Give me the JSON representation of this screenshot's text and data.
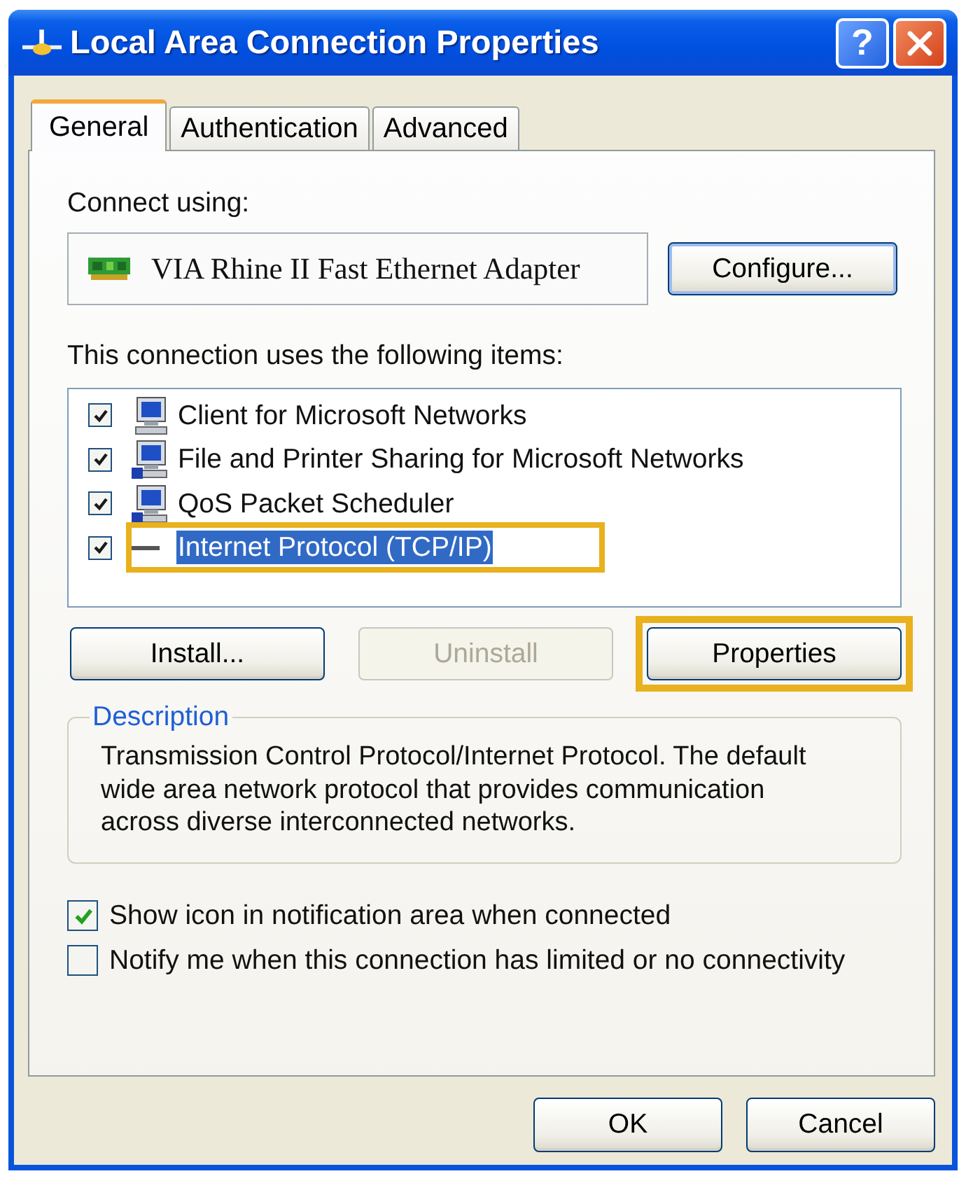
{
  "window": {
    "title": "Local Area Connection Properties",
    "help_button": "?"
  },
  "tabs": [
    {
      "label": "General",
      "selected": true
    },
    {
      "label": "Authentication",
      "selected": false
    },
    {
      "label": "Advanced",
      "selected": false
    }
  ],
  "connect_using": {
    "label": "Connect using:",
    "adapter": "VIA Rhine II Fast Ethernet Adapter",
    "button": "Configure..."
  },
  "components": {
    "label": "This connection uses the following items:",
    "items": [
      {
        "name": "Client for Microsoft Networks",
        "kind": "client",
        "checked": true,
        "selected": false,
        "highlighted": false
      },
      {
        "name": "File and Printer Sharing for Microsoft Networks",
        "kind": "service",
        "checked": true,
        "selected": false,
        "highlighted": false
      },
      {
        "name": "QoS Packet Scheduler",
        "kind": "service",
        "checked": true,
        "selected": false,
        "highlighted": false
      },
      {
        "name": "Internet Protocol (TCP/IP)",
        "kind": "protocol",
        "checked": true,
        "selected": true,
        "highlighted": true
      }
    ]
  },
  "component_buttons": [
    {
      "label": "Install...",
      "disabled": false,
      "highlighted": false
    },
    {
      "label": "Uninstall",
      "disabled": true,
      "highlighted": false
    },
    {
      "label": "Properties",
      "disabled": false,
      "highlighted": true
    }
  ],
  "description": {
    "title": "Description",
    "text": "Transmission Control Protocol/Internet Protocol. The default wide area network protocol that provides communication across diverse interconnected networks."
  },
  "options": [
    {
      "label": "Show icon in notification area when connected",
      "checked": true
    },
    {
      "label": "Notify me when this connection has limited or no connectivity",
      "checked": false
    }
  ],
  "dialog_buttons": [
    "OK",
    "Cancel"
  ]
}
